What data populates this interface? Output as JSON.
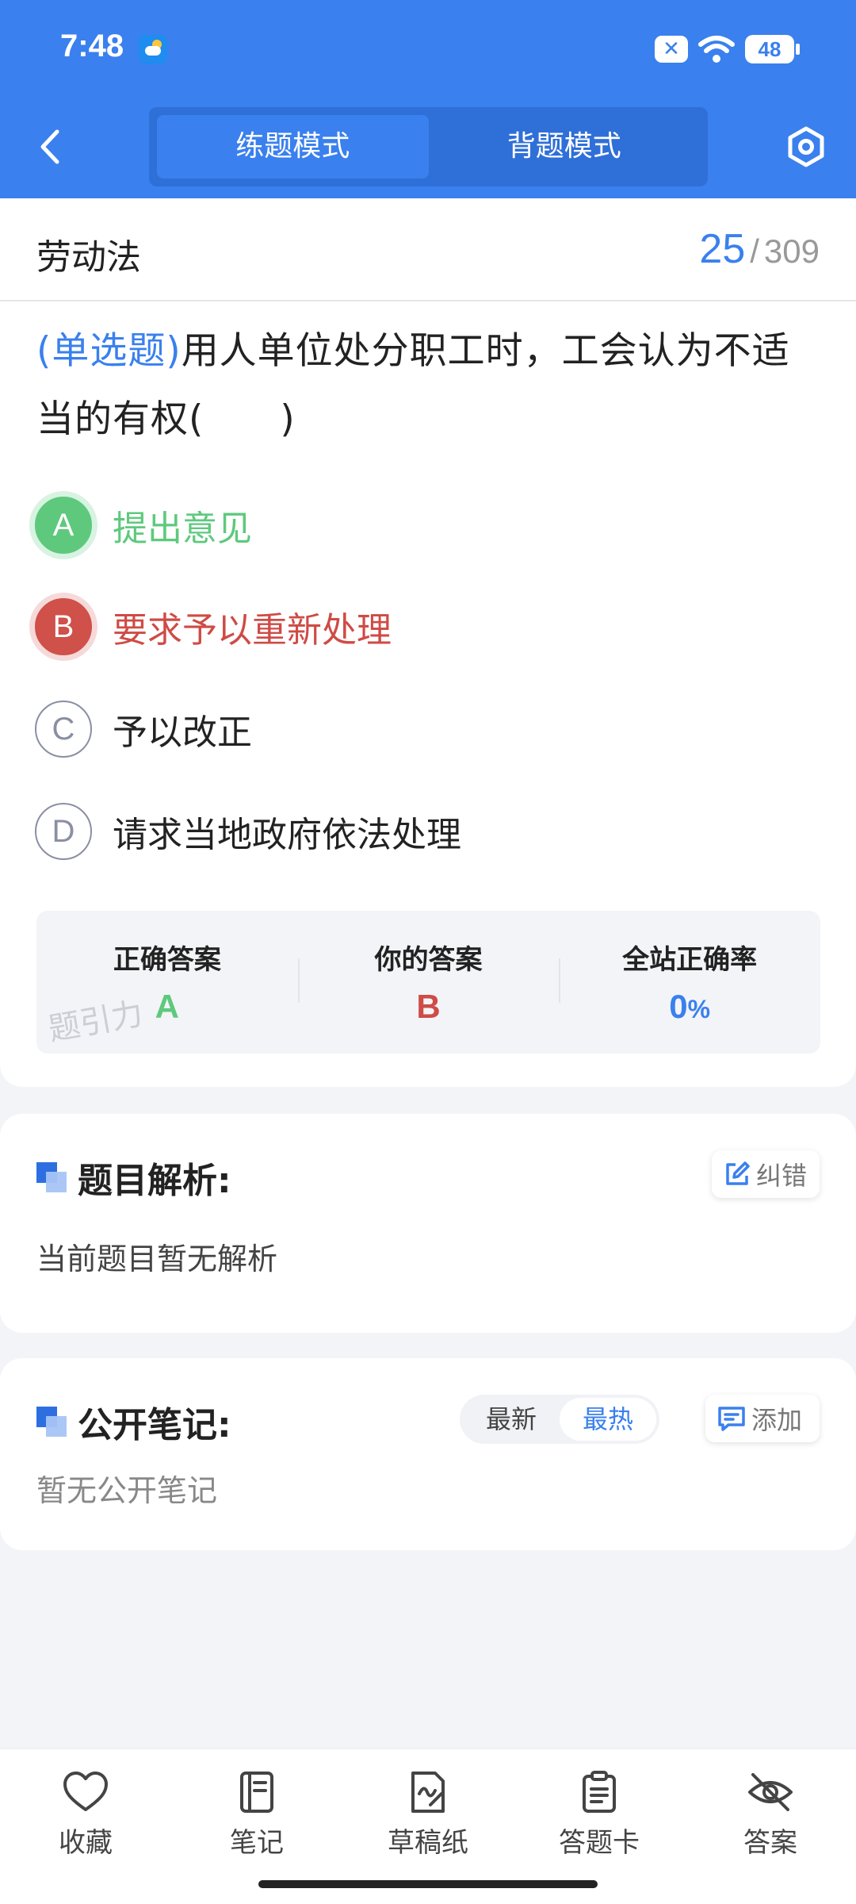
{
  "status_bar": {
    "time": "7:48",
    "battery": "48"
  },
  "header": {
    "tabs": [
      {
        "label": "练题模式",
        "active": true
      },
      {
        "label": "背题模式",
        "active": false
      }
    ]
  },
  "question": {
    "subject": "劳动法",
    "current": "25",
    "separator": "/",
    "total": "309",
    "type_label": "(单选题)",
    "text": "用人单位处分职工时，工会认为不适当的有权(　　)",
    "options": [
      {
        "letter": "A",
        "text": "提出意见",
        "state": "correct"
      },
      {
        "letter": "B",
        "text": "要求予以重新处理",
        "state": "wrong"
      },
      {
        "letter": "C",
        "text": "予以改正",
        "state": "normal"
      },
      {
        "letter": "D",
        "text": "请求当地政府依法处理",
        "state": "normal"
      }
    ]
  },
  "result": {
    "correct_title": "正确答案",
    "correct_value": "A",
    "yours_title": "你的答案",
    "yours_value": "B",
    "rate_title": "全站正确率",
    "rate_value": "0",
    "rate_unit": "%",
    "watermark": "题引力"
  },
  "analysis": {
    "title": "题目解析:",
    "report_label": "纠错",
    "body": "当前题目暂无解析"
  },
  "notes": {
    "title": "公开笔记:",
    "sort_latest": "最新",
    "sort_hot": "最热",
    "add_label": "添加",
    "body": "暂无公开笔记"
  },
  "bottom_nav": [
    {
      "label": "收藏",
      "icon": "heart-icon"
    },
    {
      "label": "笔记",
      "icon": "notebook-icon"
    },
    {
      "label": "草稿纸",
      "icon": "draft-paper-icon"
    },
    {
      "label": "答题卡",
      "icon": "answer-card-icon"
    },
    {
      "label": "答案",
      "icon": "eye-off-icon"
    }
  ],
  "colors": {
    "primary": "#3a80ee",
    "correct": "#5ec97d",
    "wrong": "#cf4b45"
  }
}
